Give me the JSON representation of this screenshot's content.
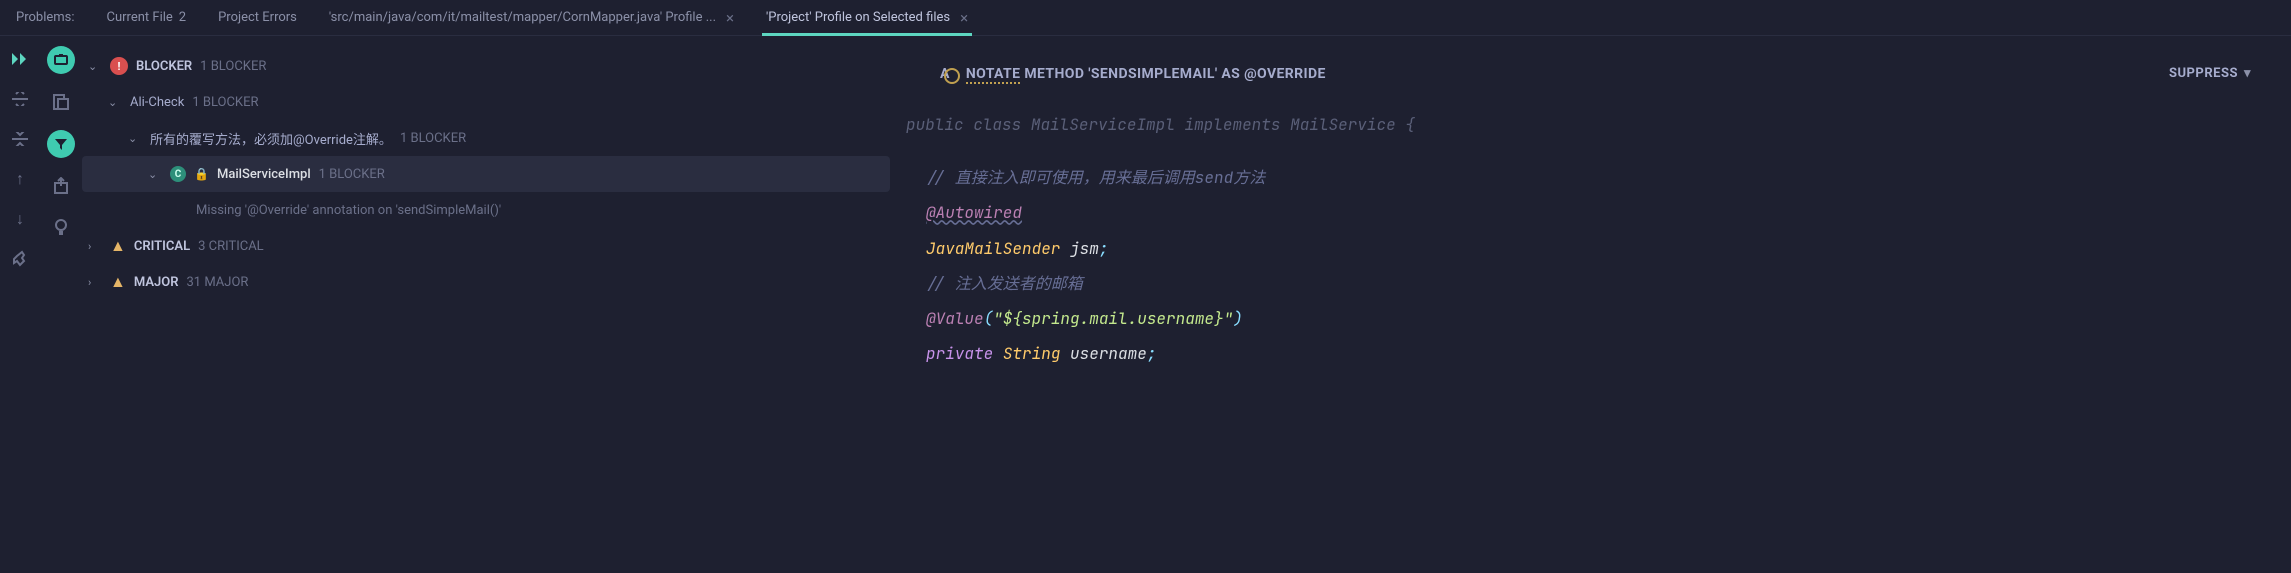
{
  "tabs": {
    "problems": "Problems:",
    "current_file": "Current File",
    "current_file_count": "2",
    "project_errors": "Project Errors",
    "profile1": "'src/main/java/com/it/mailtest/mapper/CornMapper.java' Profile ...",
    "profile2": "'Project' Profile on Selected files"
  },
  "tree": {
    "blocker": {
      "label": "BLOCKER",
      "count": "1 BLOCKER"
    },
    "alicheck": {
      "label": "Ali-Check",
      "count": "1 BLOCKER"
    },
    "rule": {
      "label": "所有的覆写方法，必须加@Override注解。",
      "count": "1 BLOCKER"
    },
    "classnode": {
      "label": "MailServiceImpl",
      "count": "1 BLOCKER"
    },
    "issue": "Missing '@Override' annotation on 'sendSimpleMail()'",
    "critical": {
      "label": "CRITICAL",
      "count": "3 CRITICAL"
    },
    "major": {
      "label": "MAJOR",
      "count": "31 MAJOR"
    }
  },
  "editor": {
    "annotate_prefix": "A",
    "annotate_mid": "NOTATE",
    "annotate_suffix": " METHOD 'SENDSIMPLEMAIL' AS @OVERRIDE",
    "suppress": "SUPPRESS",
    "line0_a": "public",
    "line0_b": "class",
    "line0_c": "MailServiceImpl",
    "line0_d": "implements",
    "line0_e": "MailService {",
    "comment1": "// 直接注入即可使用，用来最后调用send方法",
    "ann1": "@Autowired",
    "type1": "JavaMailSender",
    "ident1": " jsm",
    "semi": ";",
    "comment2": "// 注入发送者的邮箱",
    "ann2": "@Value",
    "paren_open": "(",
    "str1": "\"${spring.mail.username}\"",
    "paren_close": ")",
    "kw_private": "private",
    "type_str": "String",
    "ident2": " username"
  }
}
